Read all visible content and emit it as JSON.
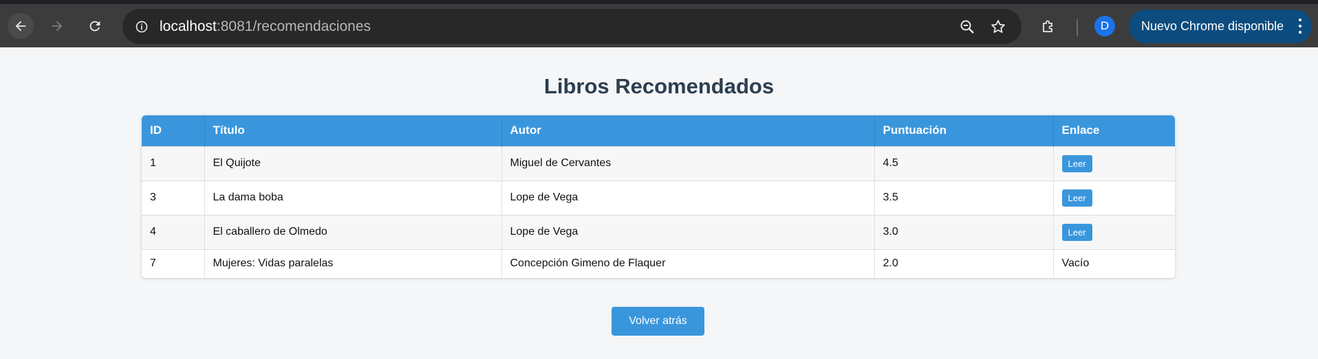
{
  "browser": {
    "url_host": "localhost",
    "url_path": ":8081/recomendaciones",
    "avatar_letter": "D",
    "update_label": "Nuevo Chrome disponible",
    "icons": [
      "back-arrow-icon",
      "forward-arrow-icon",
      "reload-icon",
      "info-icon",
      "zoom-out-icon",
      "star-icon",
      "extension-puzzle-icon",
      "more-vertical-icon"
    ]
  },
  "page": {
    "title": "Libros Recomendados",
    "back_button": "Volver atrás",
    "accent_color": "#3a96dc",
    "title_color": "#2c3e50"
  },
  "table": {
    "headers": [
      "ID",
      "Título",
      "Autor",
      "Puntuación",
      "Enlace"
    ],
    "rows": [
      {
        "id": "1",
        "title": "El Quijote",
        "author": "Miguel de Cervantes",
        "score": "4.5",
        "link": "Leer"
      },
      {
        "id": "3",
        "title": "La dama boba",
        "author": "Lope de Vega",
        "score": "3.5",
        "link": "Leer"
      },
      {
        "id": "4",
        "title": "El caballero de Olmedo",
        "author": "Lope de Vega",
        "score": "3.0",
        "link": "Leer"
      },
      {
        "id": "7",
        "title": "Mujeres: Vidas paralelas",
        "author": "Concepción Gimeno de Flaquer",
        "score": "2.0",
        "link": "Vacío"
      }
    ]
  }
}
